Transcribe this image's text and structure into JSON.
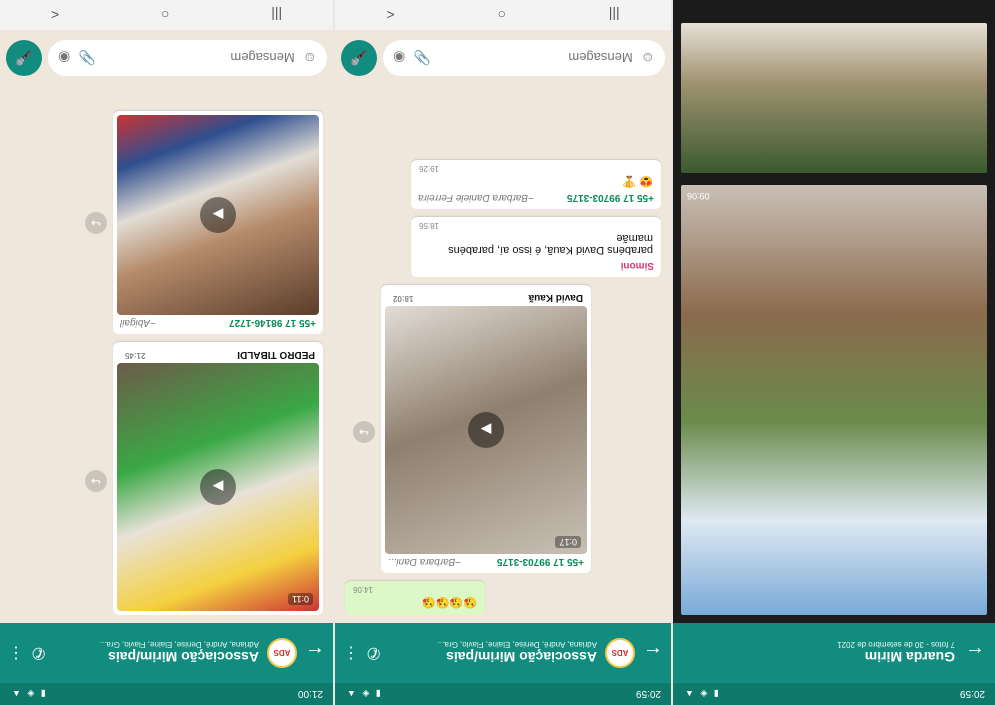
{
  "gallery": {
    "status_time": "20:59",
    "title": "Guarda Mirim",
    "subtitle": "7 fotos - 30 de setembro de 2021",
    "photo1_time": "09:06"
  },
  "chat1": {
    "status_time": "20:59",
    "group_name": "Associação Mirim/pais",
    "members": "Adriana, André, Denise, Elaine, Flavio, Gra...",
    "messages": {
      "outgoing_time": "14:06",
      "video_sender_phone": "+55 17 99703-3175",
      "video_sender_name": "~Barbara Dani...",
      "video_duration": "0:17",
      "video_caption": "David Kauã",
      "video_time": "18:02",
      "text_sender": "Simoni",
      "text_body": "parabéns David Kauã, é isso aí, parabéns mamãe",
      "text_time": "18:56",
      "emoji_sender_phone": "+55 17 99703-3175",
      "emoji_sender_name": "~Barbara Daniele Ferreira",
      "emoji_time": "19:26"
    },
    "input_placeholder": "Mensagem"
  },
  "chat2": {
    "status_time": "21:00",
    "group_name": "Associação Mirim/pais",
    "members": "Adriana, André, Denise, Elaine, Flavio, Gra...",
    "messages": {
      "video1_duration": "0:11",
      "video1_caption": "PEDRO TIBALDI",
      "video1_time": "21:45",
      "video2_sender_phone": "+55 17 98146-1727",
      "video2_sender_name": "~Abigail"
    },
    "input_placeholder": "Mensagem"
  }
}
